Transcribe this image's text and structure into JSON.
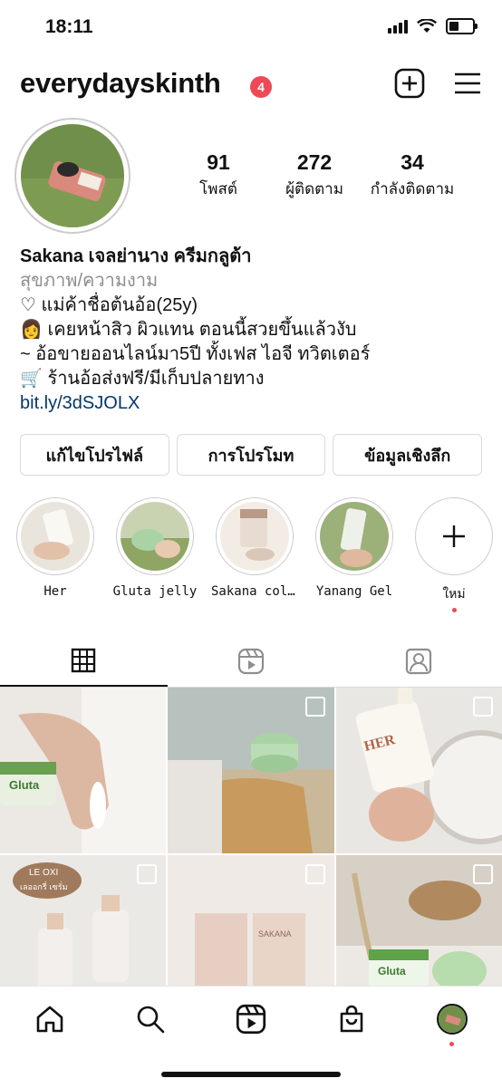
{
  "status_bar": {
    "time": "18:11"
  },
  "header": {
    "username": "everydayskinth",
    "notification_count": "4"
  },
  "stats": [
    {
      "value": "91",
      "label": "โพสต์"
    },
    {
      "value": "272",
      "label": "ผู้ติดตาม"
    },
    {
      "value": "34",
      "label": "กำลังติดตาม"
    }
  ],
  "bio": {
    "name": "Sakana เจลย่านาง ครีมกลูต้า",
    "category": "สุขภาพ/ความงาม",
    "lines": [
      "♡ แม่ค้าชื่อต้นอ้อ(25y)",
      "👩 เคยหน้าสิว ผิวแทน ตอนนี้สวยขึ้นแล้วงับ",
      "~ อ้อขายออนไลน์มา5ปี ทั้งเฟส ไอจี ทวิตเตอร์",
      "🛒 ร้านอ้อส่งฟรี/มีเก็บปลายทาง"
    ],
    "link": "bit.ly/3dSJOLX"
  },
  "buttons": {
    "edit_profile": "แก้ไขโปรไฟล์",
    "promotions": "การโปรโมท",
    "insights": "ข้อมูลเชิงลึก"
  },
  "highlights": [
    {
      "label": "Her"
    },
    {
      "label": "Gluta jelly"
    },
    {
      "label": "Sakana colla..."
    },
    {
      "label": "Yanang Gel"
    },
    {
      "label": "ใหม่"
    }
  ],
  "grid_overlays": {
    "cell1_brand": "Gluta",
    "cell3_brand": "HER",
    "cell4_caption_1": "LE OXI",
    "cell4_caption_2": "เลออกรี่ เซรั่ม",
    "cell5_brand": "SAKANA",
    "cell6_brand": "Gluta"
  },
  "colors": {
    "accent_red": "#ed4956",
    "link_blue": "#00376b"
  }
}
